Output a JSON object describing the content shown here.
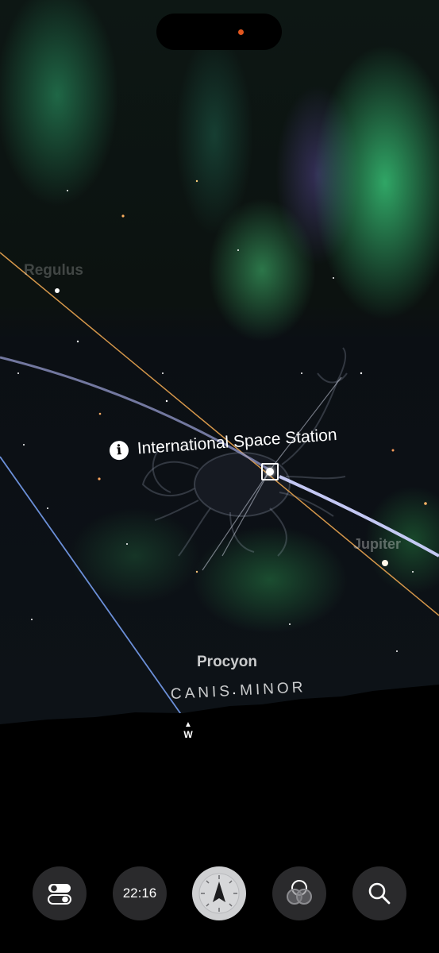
{
  "sky_view": {
    "labels": {
      "regulus": "Regulus",
      "jupiter": "Jupiter",
      "procyon": "Procyon",
      "constellation": "CANIS MINOR"
    },
    "selected_object": {
      "name": "International Space Station",
      "info_glyph": "i"
    },
    "horizon_direction": "W"
  },
  "toolbar": {
    "time": "22:16",
    "items": [
      "layers-toggle-icon",
      "time",
      "compass-icon",
      "overlapping-circles-icon",
      "search-icon"
    ]
  },
  "colors": {
    "ecliptic_line": "#d4964a",
    "iss_path": "#9aa0d8",
    "meridian_line": "#6b8fd8",
    "aurora": "#3fcf7e",
    "island_dot": "#e2571f"
  }
}
